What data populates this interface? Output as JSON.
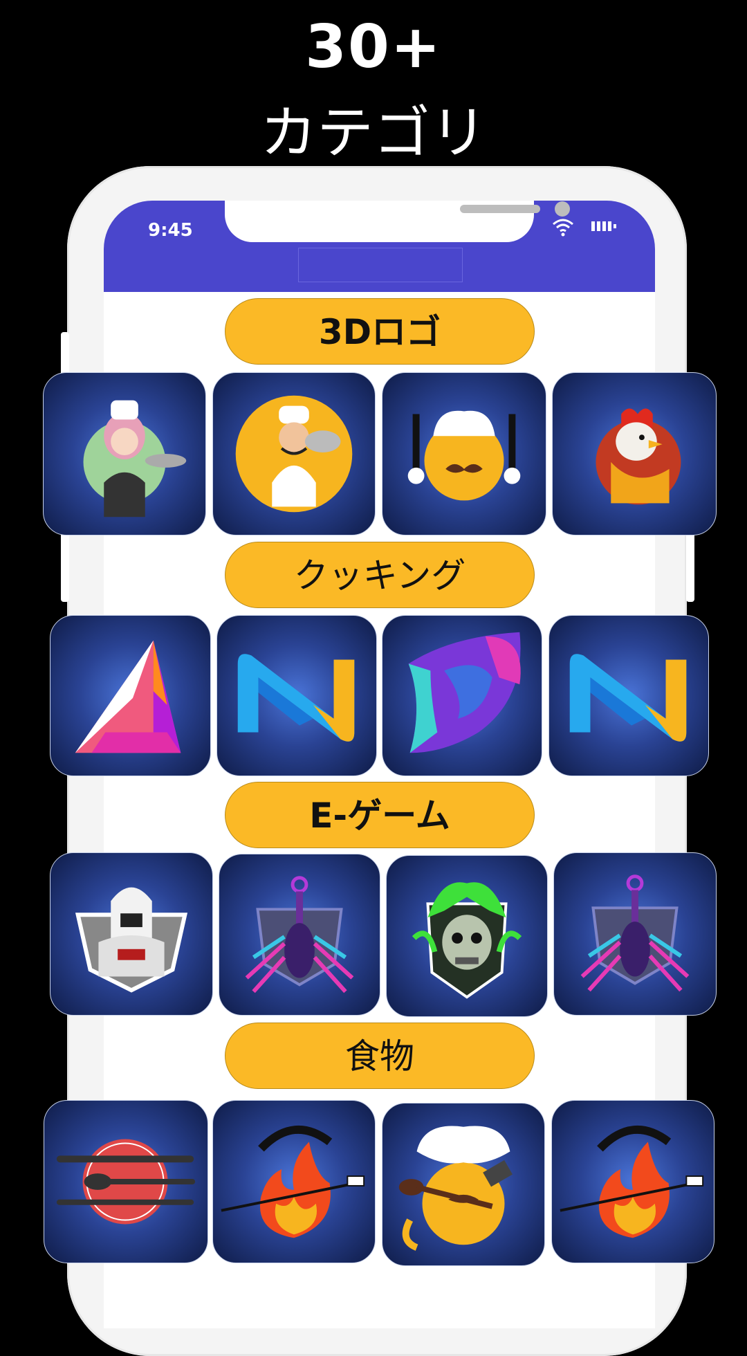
{
  "promo": {
    "headline": "30+",
    "subtitle": "カテゴリ"
  },
  "status_bar": {
    "time": "9:45",
    "wifi_icon": "wifi-icon",
    "battery_icon": "battery-icon"
  },
  "colors": {
    "status_bar": "#4a46cc",
    "category_pill": "#fbb926",
    "tile_center": "#4a74d8",
    "tile_edge": "#0f1c48"
  },
  "categories": [
    {
      "label": "3Dロゴ",
      "tiles": [
        "chef-woman-logo",
        "chef-serving-logo",
        "chef-mustache-logo",
        "rooster-logo"
      ]
    },
    {
      "label": "クッキング",
      "tiles": [
        "letter-a-3d-logo",
        "letter-n-3d-logo",
        "letter-b-3d-logo",
        "letter-n-3d-logo"
      ]
    },
    {
      "label": "E-ゲーム",
      "tiles": [
        "ninja-esports-logo",
        "scorpion-esports-logo",
        "green-skull-esports-logo",
        "scorpion-esports-logo"
      ]
    },
    {
      "label": "食物",
      "tiles": [
        "plate-cutlery-logo",
        "flame-spatula-logo",
        "chef-pot-logo",
        "flame-spatula-logo"
      ]
    }
  ]
}
